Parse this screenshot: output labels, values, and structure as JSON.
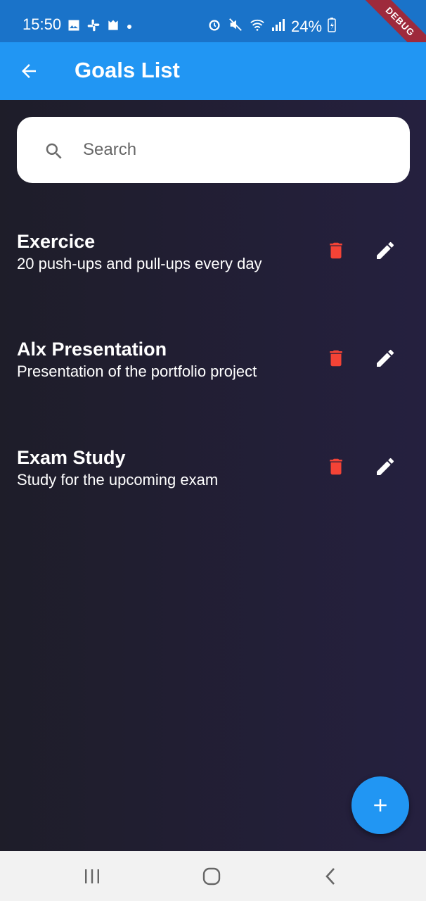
{
  "status_bar": {
    "time": "15:50",
    "battery": "24%",
    "debug_label": "DEBUG",
    "left_icons": [
      "image-icon",
      "slack-icon",
      "ghost-icon",
      "dot-icon"
    ],
    "right_icons": [
      "alarm-icon",
      "mute-icon",
      "wifi-icon",
      "signal-icon",
      "battery-charging-icon"
    ]
  },
  "app_bar": {
    "title": "Goals List",
    "back_icon": "arrow-left-icon",
    "background": "#2196f3"
  },
  "search": {
    "placeholder": "Search",
    "value": "",
    "icon": "search-icon"
  },
  "goals": [
    {
      "title": "Exercice",
      "description": "20 push-ups and pull-ups every day"
    },
    {
      "title": "Alx Presentation",
      "description": "Presentation of the portfolio project"
    },
    {
      "title": "Exam Study",
      "description": "Study for the upcoming exam"
    }
  ],
  "actions": {
    "delete_icon": "trash-icon",
    "delete_color": "#f44336",
    "edit_icon": "pencil-icon",
    "edit_color": "#ffffff"
  },
  "fab": {
    "icon": "plus-icon",
    "color": "#2196f3"
  },
  "nav_bar": {
    "items": [
      "recents-icon",
      "home-icon",
      "back-icon"
    ]
  }
}
